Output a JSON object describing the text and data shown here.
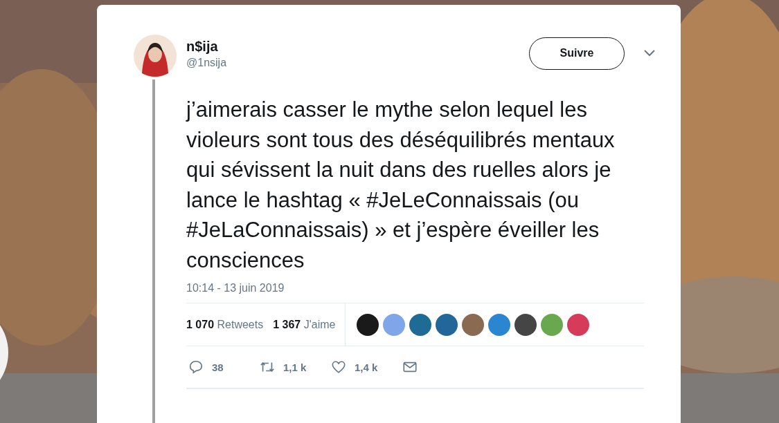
{
  "tweet": {
    "author": {
      "name": "n$ija",
      "handle": "@1nsija"
    },
    "follow_button": "Suivre",
    "text": "j’aimerais casser le mythe selon lequel les violeurs sont tous des déséquilibrés mentaux qui sévissent la nuit dans des ruelles alors je lance le hashtag « #JeLeConnaissais (ou #JeLaConnaissais) » et j’espère éveiller les consciences",
    "timestamp": "10:14 - 13 juin 2019",
    "stats": [
      {
        "count": "1 070",
        "label": "Retweets"
      },
      {
        "count": "1 367",
        "label": "J'aime"
      }
    ],
    "likers": [
      {
        "color": "#1a1a1a"
      },
      {
        "color": "#7fa6e8"
      },
      {
        "color": "#1e6b96"
      },
      {
        "color": "#22679a"
      },
      {
        "color": "#8a6a50"
      },
      {
        "color": "#2a86d0"
      },
      {
        "color": "#454545"
      },
      {
        "color": "#6aa84f"
      },
      {
        "color": "#d63c5a"
      }
    ],
    "actions": [
      {
        "kind": "reply",
        "count": "38"
      },
      {
        "kind": "retweet",
        "count": "1,1 k"
      },
      {
        "kind": "like",
        "count": "1,4 k"
      },
      {
        "kind": "message"
      }
    ]
  }
}
